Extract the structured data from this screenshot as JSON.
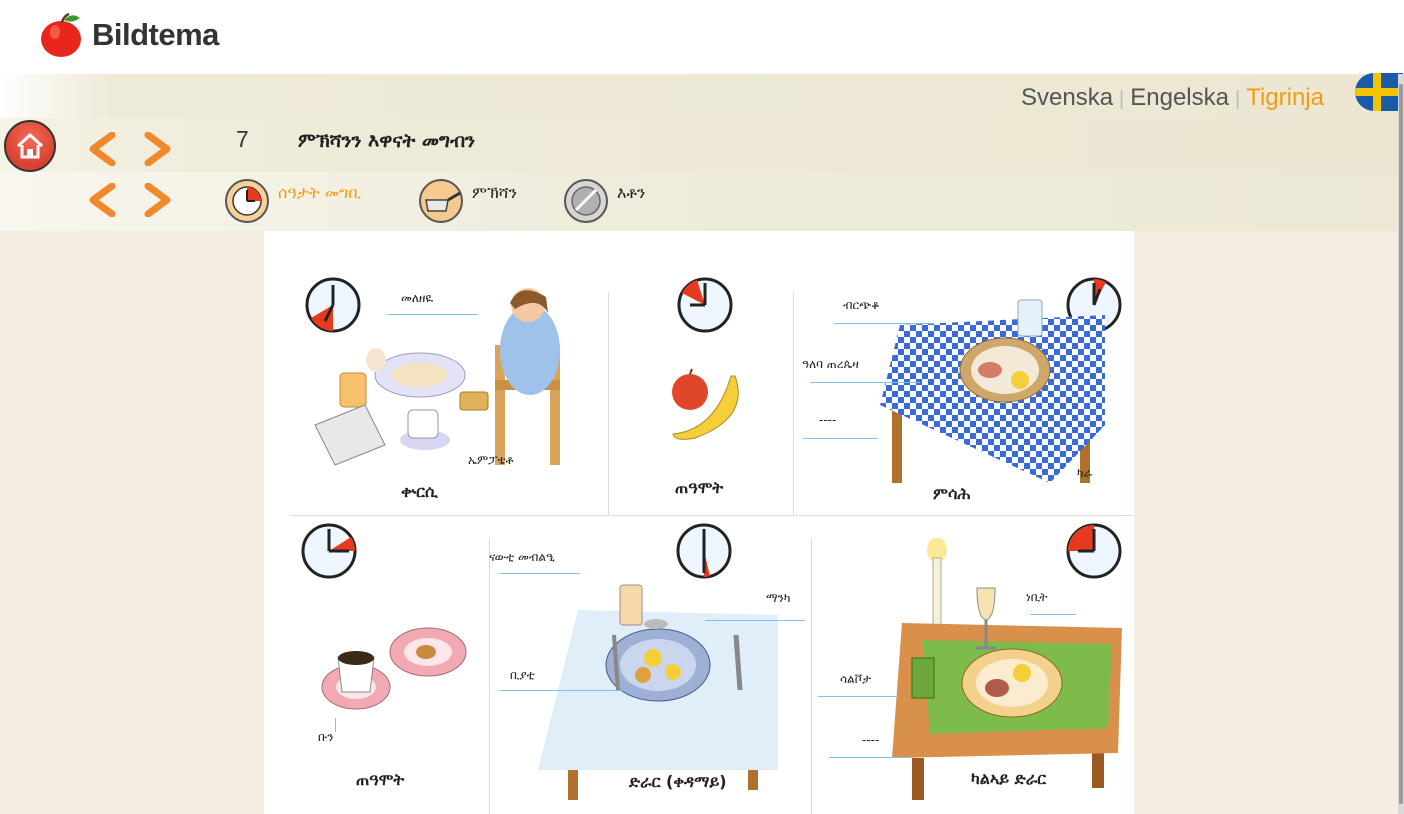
{
  "brand": {
    "name": "Bildtema"
  },
  "languages": {
    "items": [
      "Svenska",
      "Engelska",
      "Tigrinja"
    ],
    "active": "Tigrinja"
  },
  "nav": {
    "page_number": "7",
    "page_title": "ምኽሻንን እዋናት መግብን",
    "subtabs": [
      {
        "label": "ሰዓታት መግቢ",
        "icon": "clock-icon",
        "active": true
      },
      {
        "label": "ምኽሻን",
        "icon": "pan-icon",
        "active": false
      },
      {
        "label": "እቶን",
        "icon": "stove-icon",
        "active": false
      }
    ]
  },
  "panels": {
    "breakfast": {
      "caption": "ቍርሲ",
      "labels": [
        "መለዘዪ",
        "ኤምፓቴቶ"
      ]
    },
    "snack1": {
      "caption": "ጠዓሞት"
    },
    "lunch": {
      "caption": "ምሳሕ",
      "labels": [
        "ብርጭቆ",
        "ዓለባ ጠረጴዛ",
        "----",
        "ካራ"
      ]
    },
    "snack2": {
      "caption": "ጠዓሞት",
      "labels": [
        "ቡን"
      ]
    },
    "dinner": {
      "caption": "ድራር (ቀዳማይ)",
      "labels": [
        "ናውቲ መብልዒ",
        "ማንካ",
        "ቢያቲ"
      ]
    },
    "late_dinner": {
      "caption": "ካልኣይ ድራር",
      "labels": [
        "ነቢት",
        "ሳልቮታ",
        "----"
      ]
    }
  },
  "colors": {
    "accent": "#f39c12",
    "home": "#d8402f",
    "leader": "#7fc2e8",
    "clock_red": "#e53a1f"
  }
}
